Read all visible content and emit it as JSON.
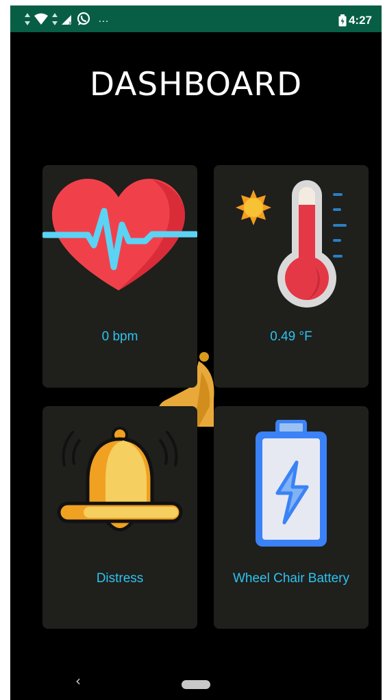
{
  "status_bar": {
    "time": "4:27",
    "overflow": "…",
    "icons": [
      "data-arrows-icon",
      "wifi-icon",
      "signal-icon",
      "whatsapp-icon",
      "battery-icon"
    ],
    "color": "#075e45"
  },
  "dashboard": {
    "title": "DASHBOARD",
    "cards": [
      {
        "label": "0 bpm",
        "icon": "heart-pulse-icon"
      },
      {
        "label": "0.49 °F",
        "icon": "thermometer-sun-icon"
      },
      {
        "label": "Distress",
        "icon": "bell-icon"
      },
      {
        "label": "Wheel Chair Battery",
        "icon": "battery-charging-icon"
      }
    ]
  },
  "navigation": {
    "back": "‹",
    "home": "home-pill"
  },
  "colors": {
    "background": "#000000",
    "card": "#1f1f1c",
    "label": "#2cc4f0",
    "heart": "#f0414b",
    "pulse": "#5bd3f5",
    "bell": "#f5c542",
    "battery_frame": "#3b82f6"
  }
}
